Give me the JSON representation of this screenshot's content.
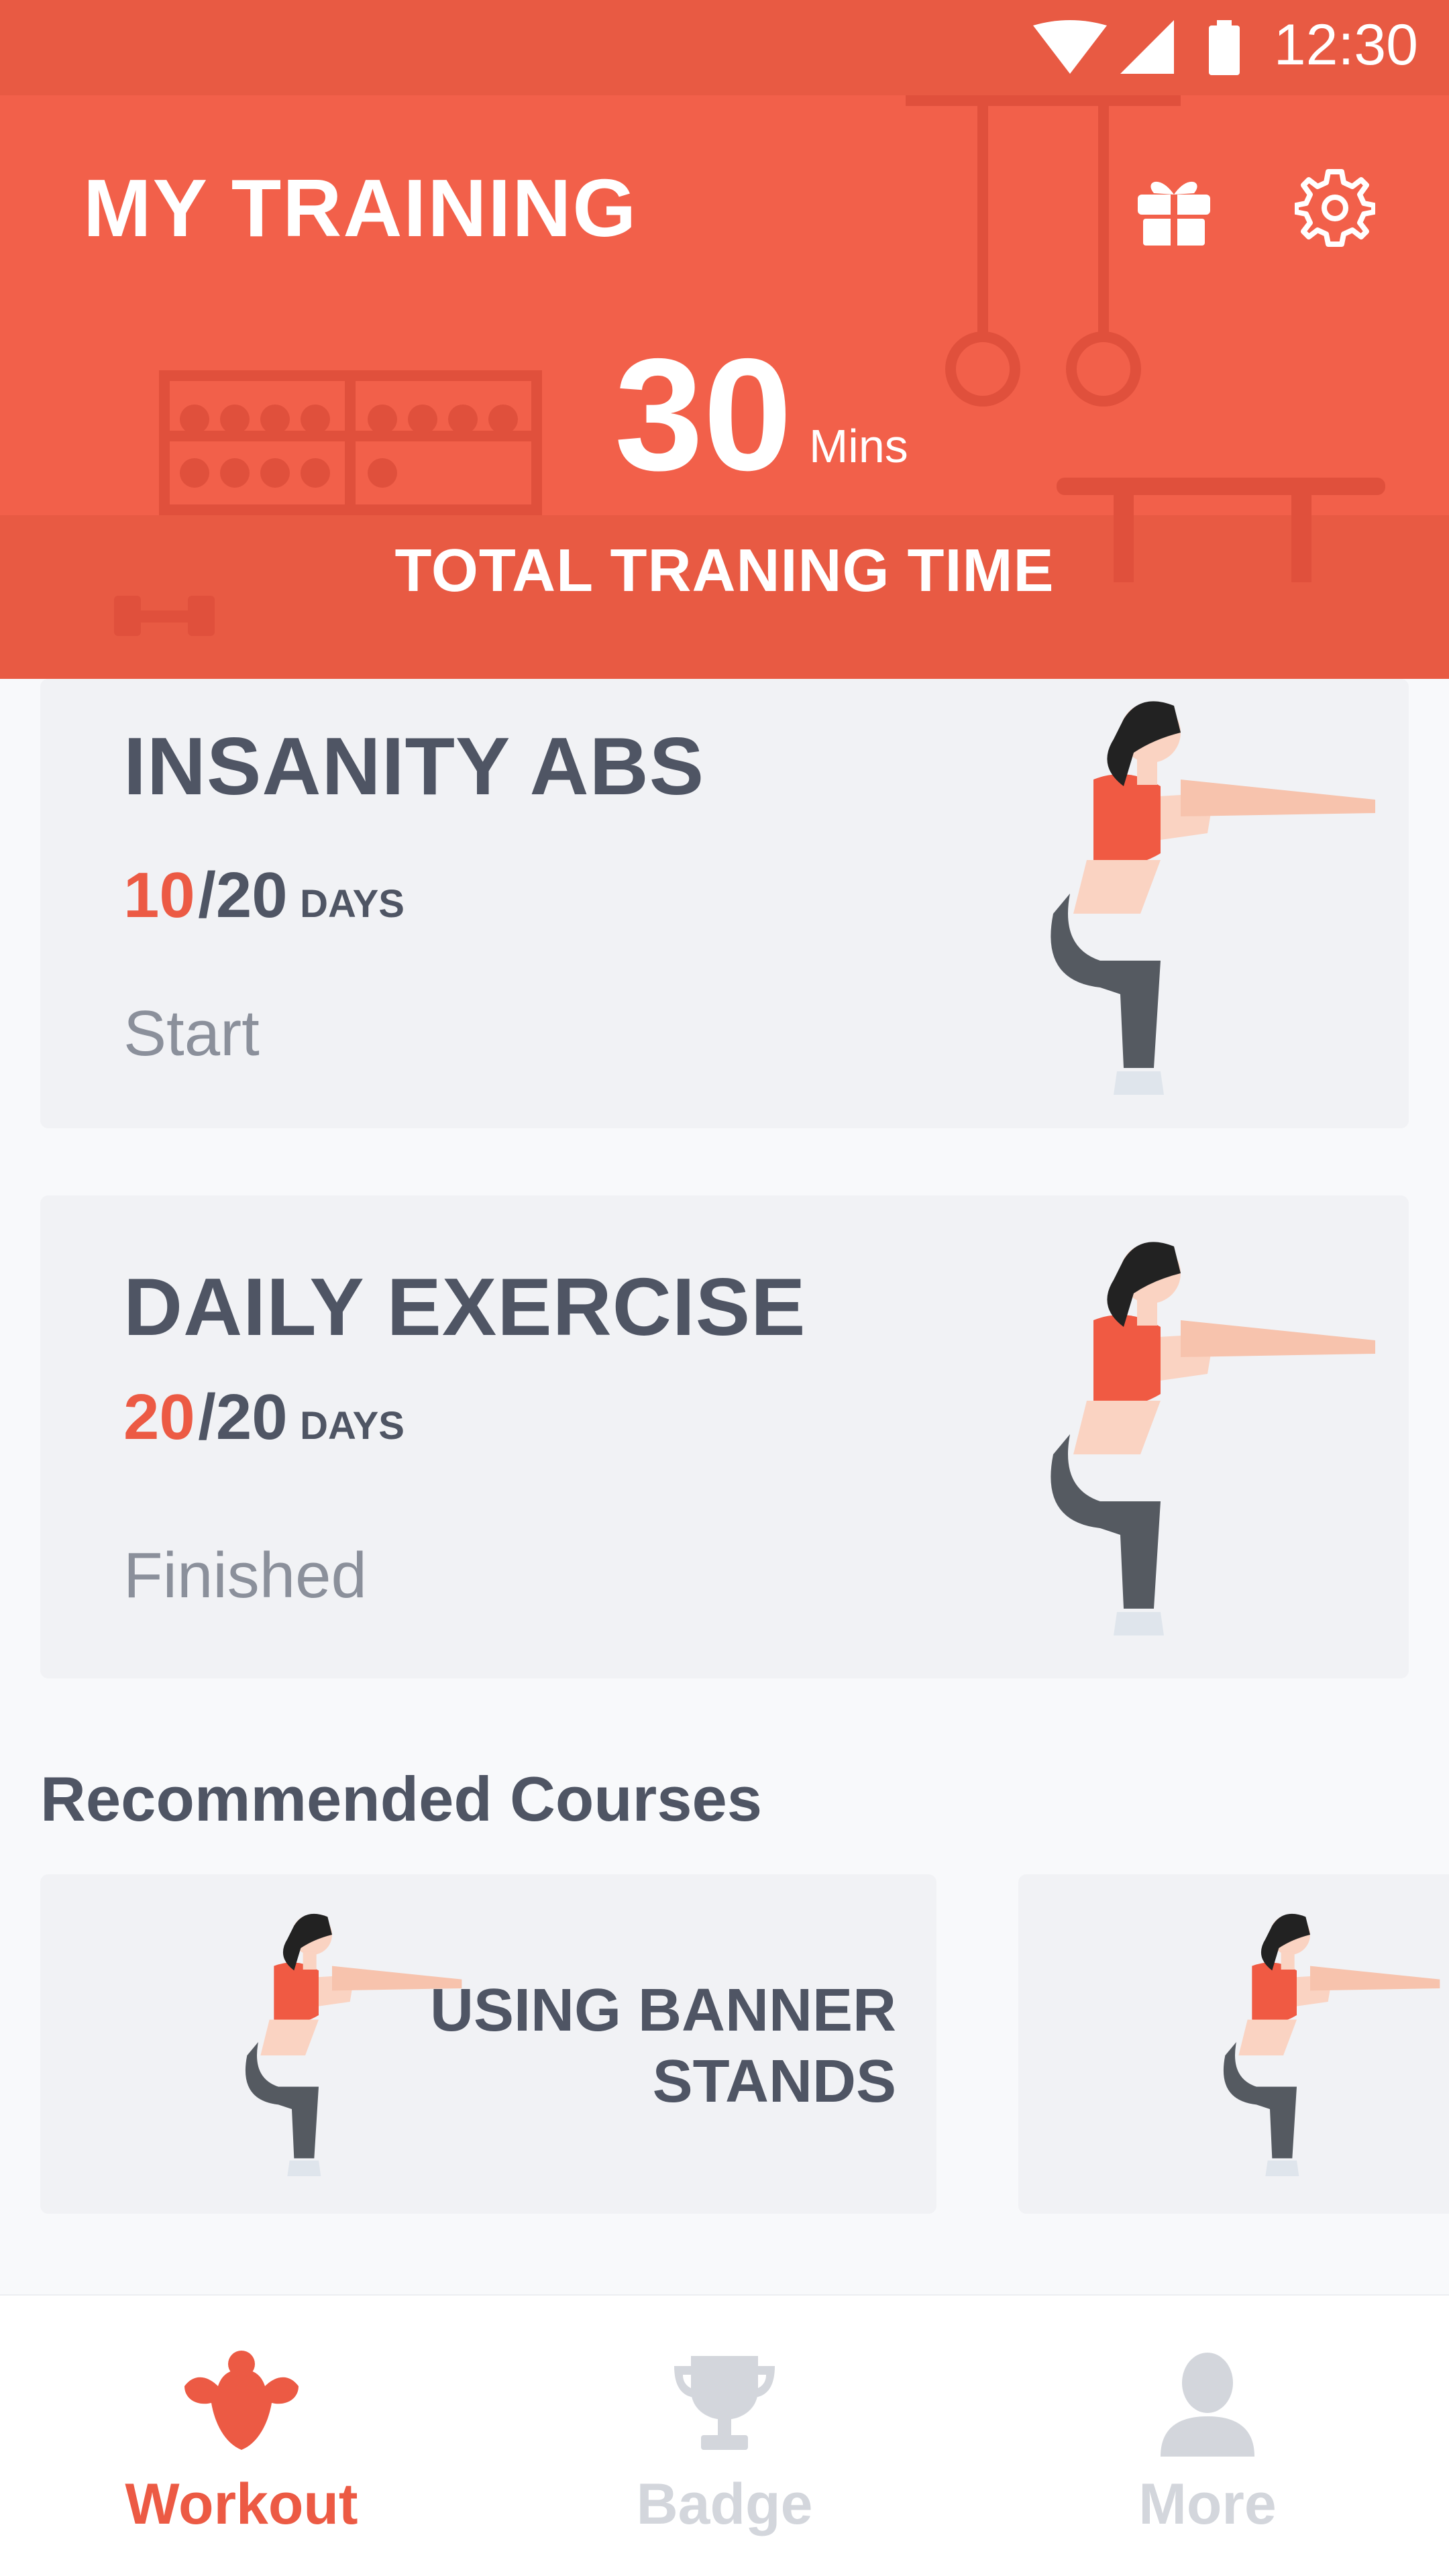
{
  "status_bar": {
    "time": "12:30"
  },
  "header": {
    "title": "MY TRAINING",
    "total_time_value": "30",
    "total_time_unit": "Mins",
    "total_time_label": "TOTAL TRANING TIME",
    "accent_color": "#f2604a"
  },
  "programs": [
    {
      "title": "INSANITY ABS",
      "days_done": "10",
      "days_total": "/20",
      "days_unit": "DAYS",
      "status": "Start"
    },
    {
      "title": "DAILY EXERCISE",
      "days_done": "20",
      "days_total": "/20",
      "days_unit": "DAYS",
      "status": "Finished"
    }
  ],
  "recommended": {
    "section_title": "Recommended Courses",
    "courses": [
      {
        "title_line1": "USING BANNER",
        "title_line2": "STANDS"
      }
    ]
  },
  "bottom_nav": {
    "items": [
      {
        "label": "Workout",
        "icon": "muscle-icon",
        "active": true
      },
      {
        "label": "Badge",
        "icon": "trophy-icon",
        "active": false
      },
      {
        "label": "More",
        "icon": "person-icon",
        "active": false
      }
    ],
    "active_color": "#ec5a44",
    "inactive_color": "#d3d6dc"
  }
}
